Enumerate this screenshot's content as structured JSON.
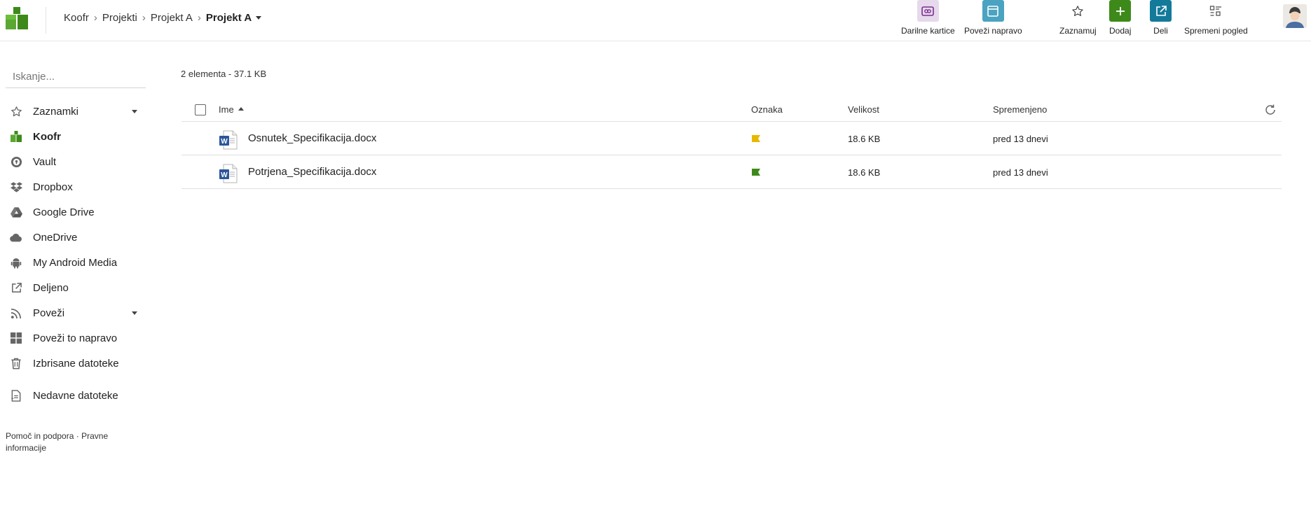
{
  "breadcrumb": {
    "items": [
      "Koofr",
      "Projekti",
      "Projekt A"
    ],
    "current": "Projekt A"
  },
  "toolbar": {
    "actions": [
      {
        "label": "Darilne kartice",
        "icon": "gift-card-icon",
        "color": "#e6d9ec"
      },
      {
        "label": "Poveži napravo",
        "icon": "device-icon",
        "color": "#4aa3c0"
      },
      {
        "label": "Zaznamuj",
        "icon": "star-icon",
        "color": "#ffffff"
      },
      {
        "label": "Dodaj",
        "icon": "plus-icon",
        "color": "#3d8a1a"
      },
      {
        "label": "Deli",
        "icon": "share-icon",
        "color": "#137a9a"
      },
      {
        "label": "Spremeni pogled",
        "icon": "view-toggle-icon",
        "color": "#ffffff"
      }
    ]
  },
  "sidebar": {
    "search_placeholder": "Iskanje...",
    "items": [
      {
        "label": "Zaznamki",
        "icon": "star-icon",
        "has_caret": true
      },
      {
        "label": "Koofr",
        "icon": "koofr-icon",
        "active": true
      },
      {
        "label": "Vault",
        "icon": "vault-icon"
      },
      {
        "label": "Dropbox",
        "icon": "dropbox-icon"
      },
      {
        "label": "Google Drive",
        "icon": "google-drive-icon"
      },
      {
        "label": "OneDrive",
        "icon": "cloud-icon"
      },
      {
        "label": "My Android Media",
        "icon": "android-icon"
      },
      {
        "label": "Deljeno",
        "icon": "share-icon"
      },
      {
        "label": "Poveži",
        "icon": "rss-icon",
        "has_caret": true
      },
      {
        "label": "Poveži to napravo",
        "icon": "windows-icon"
      },
      {
        "label": "Izbrisane datoteke",
        "icon": "trash-icon"
      },
      {
        "label": "Nedavne datoteke",
        "icon": "recent-files-icon"
      }
    ],
    "footer": {
      "help": "Pomoč in podpora",
      "separator": "·",
      "legal": "Pravne informacije"
    }
  },
  "main": {
    "summary": "2 elementa - 37.1 KB",
    "columns": {
      "name": "Ime",
      "tag": "Oznaka",
      "size": "Velikost",
      "modified": "Spremenjeno"
    },
    "files": [
      {
        "name": "Osnutek_Specifikacija.docx",
        "tag_color": "#e8b800",
        "size": "18.6 KB",
        "modified": "pred 13 dnevi"
      },
      {
        "name": "Potrjena_Specifikacija.docx",
        "tag_color": "#3d8a1a",
        "size": "18.6 KB",
        "modified": "pred 13 dnevi"
      }
    ]
  },
  "colors": {
    "brand": "#3d8a1a",
    "share": "#137a9a",
    "device": "#4aa3c0"
  }
}
